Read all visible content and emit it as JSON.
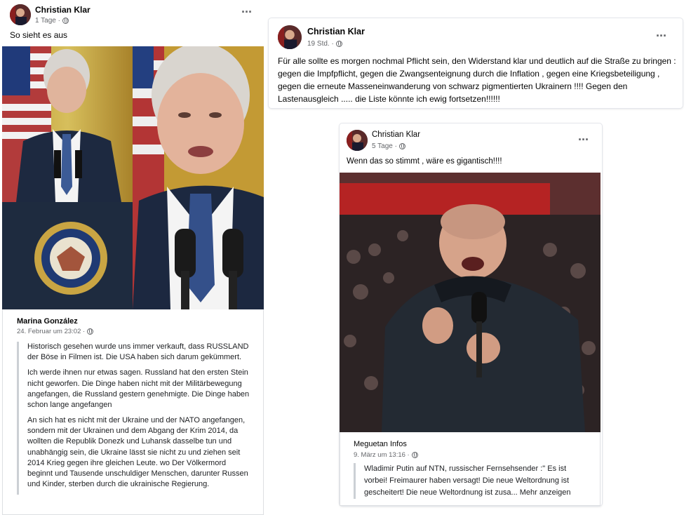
{
  "post_left": {
    "author": "Christian Klar",
    "time": "1 Tage ·",
    "text": "So sieht es aus",
    "shared": {
      "author": "Marina González",
      "time": "24. Februar um 23:02 ·",
      "paragraphs": [
        "Historisch gesehen wurde uns immer verkauft, dass RUSSLAND der Böse in Filmen ist. Die USA haben sich darum gekümmert.",
        "Ich werde ihnen nur etwas sagen. Russland hat den ersten Stein nicht geworfen. Die Dinge haben nicht mit der Militärbewegung angefangen, die Russland gestern genehmigte. Die Dinge haben schon lange angefangen",
        "An sich hat es nicht mit der Ukraine und der NATO angefangen, sondern mit der Ukrainen und dem Abgang der Krim 2014, da wollten die Republik Donezk und Luhansk dasselbe tun und unabhängig sein, die Ukraine lässt sie nicht zu und ziehen seit 2014 Krieg gegen ihre gleichen Leute. wo Der Völkermord beginnt und Tausende unschuldiger Menschen, darunter Russen und Kinder, sterben durch die ukrainische Regierung."
      ]
    }
  },
  "post_right": {
    "author": "Christian Klar",
    "time": "19 Std. ·",
    "text": "Für alle sollte es morgen nochmal Pflicht sein, den Widerstand klar und deutlich auf die Straße zu bringen : gegen die Impfpflicht, gegen die Zwangsenteignung durch die Inflation , gegen eine Kriegsbeteiligung , gegen die erneute Masseneinwanderung von schwarz pigmentierten Ukrainern !!!! Gegen den Lastenausgleich ..... die Liste könnte ich ewig fortsetzen!!!!!!"
  },
  "post_middle": {
    "author": "Christian Klar",
    "time": "5 Tage ·",
    "text": "Wenn das so stimmt , wäre es gigantisch!!!!",
    "shared": {
      "author": "Meguetan Infos",
      "time": "9. März um 13:16 ·",
      "text": "Wladimir Putin auf NTN, russischer Fernsehsender :\" Es ist vorbei! Freimaurer haben versagt! Die neue Weltordnung ist gescheitert! Die neue Weltordnung ist zusa...",
      "more": "Mehr anzeigen"
    }
  },
  "seal_text": "SEAL OF THE PRESIDENT OF THE UNITED STATES",
  "menu_icon": "more-horizontal-icon",
  "colors": {
    "meta": "#65676b",
    "text": "#050505",
    "quote_border": "#ccd0d5"
  }
}
